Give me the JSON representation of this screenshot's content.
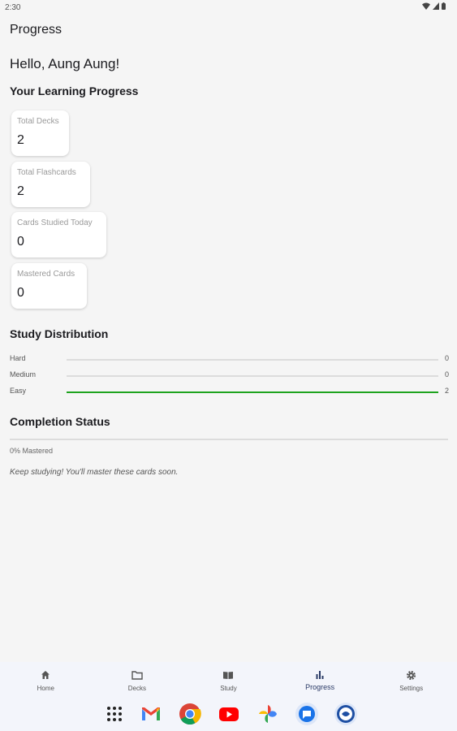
{
  "status": {
    "time": "2:30"
  },
  "app": {
    "title": "Progress"
  },
  "greeting": "Hello, Aung Aung!",
  "progress_section": {
    "title": "Your Learning Progress",
    "cards": [
      {
        "label": "Total Decks",
        "value": "2"
      },
      {
        "label": "Total Flashcards",
        "value": "2"
      },
      {
        "label": "Cards Studied Today",
        "value": "0"
      },
      {
        "label": "Mastered Cards",
        "value": "0"
      }
    ]
  },
  "distribution": {
    "title": "Study Distribution",
    "rows": [
      {
        "label": "Hard",
        "count": "0",
        "fraction": 0,
        "color": "#dcdcdc"
      },
      {
        "label": "Medium",
        "count": "0",
        "fraction": 0,
        "color": "#dcdcdc"
      },
      {
        "label": "Easy",
        "count": "2",
        "fraction": 1,
        "color": "#1ea31e"
      }
    ]
  },
  "completion": {
    "title": "Completion Status",
    "percent_text": "0% Mastered",
    "fraction": 0,
    "message": "Keep studying! You'll master these cards soon."
  },
  "nav": {
    "items": [
      {
        "label": "Home",
        "icon": "home-icon"
      },
      {
        "label": "Decks",
        "icon": "folder-icon"
      },
      {
        "label": "Study",
        "icon": "book-icon"
      },
      {
        "label": "Progress",
        "icon": "bar-chart-icon",
        "active": true
      },
      {
        "label": "Settings",
        "icon": "gear-icon"
      }
    ]
  },
  "dock": {
    "apps": [
      "app-drawer-icon",
      "gmail-icon",
      "chrome-icon",
      "youtube-icon",
      "photos-icon",
      "messages-icon",
      "flashcard-app-icon"
    ]
  },
  "colors": {
    "accent": "#2a3a66",
    "easy": "#1ea31e",
    "background": "#f5f5f5"
  }
}
